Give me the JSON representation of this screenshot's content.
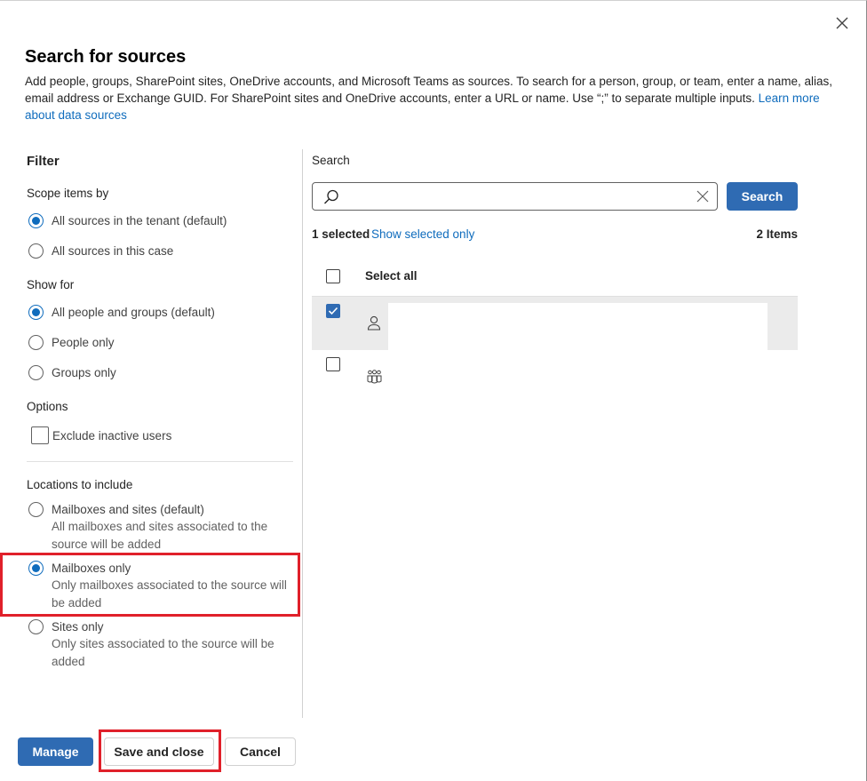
{
  "dialog": {
    "title": "Search for sources",
    "description": "Add people, groups, SharePoint sites, OneDrive accounts, and Microsoft Teams as sources. To search for a person, group, or team, enter a name, alias, email address or Exchange GUID. For SharePoint sites and OneDrive accounts, enter a URL or name. Use “;” to separate multiple inputs.",
    "learn_more_link": "Learn more about data sources"
  },
  "filter": {
    "heading": "Filter",
    "scope": {
      "label": "Scope items by",
      "options": [
        {
          "label": "All sources in the tenant (default)",
          "selected": true
        },
        {
          "label": "All sources in this case",
          "selected": false
        }
      ]
    },
    "show_for": {
      "label": "Show for",
      "options": [
        {
          "label": "All people and groups (default)",
          "selected": true
        },
        {
          "label": "People only",
          "selected": false
        },
        {
          "label": "Groups only",
          "selected": false
        }
      ]
    },
    "options": {
      "label": "Options",
      "exclude_inactive": {
        "label": "Exclude inactive users",
        "checked": false
      }
    },
    "locations": {
      "label": "Locations to include",
      "options": [
        {
          "label": "Mailboxes and sites (default)",
          "sub": "All mailboxes and sites associated to the source will be added",
          "selected": false
        },
        {
          "label": "Mailboxes only",
          "sub": "Only mailboxes associated to the source will be added",
          "selected": true
        },
        {
          "label": "Sites only",
          "sub": "Only sites associated to the source will be added",
          "selected": false
        }
      ]
    }
  },
  "search": {
    "label": "Search",
    "value": "",
    "button": "Search",
    "selected_count": "1 selected",
    "show_selected_link": "Show selected only",
    "items_count": "2 Items",
    "select_all_label": "Select all",
    "rows": [
      {
        "checked": true,
        "icon": "person-icon"
      },
      {
        "checked": false,
        "icon": "group-icon"
      }
    ]
  },
  "footer": {
    "manage": "Manage",
    "save_and_close": "Save and close",
    "cancel": "Cancel"
  },
  "colors": {
    "accent": "#2f6bb3",
    "link": "#0f6cbd",
    "highlight": "#e0202a"
  }
}
